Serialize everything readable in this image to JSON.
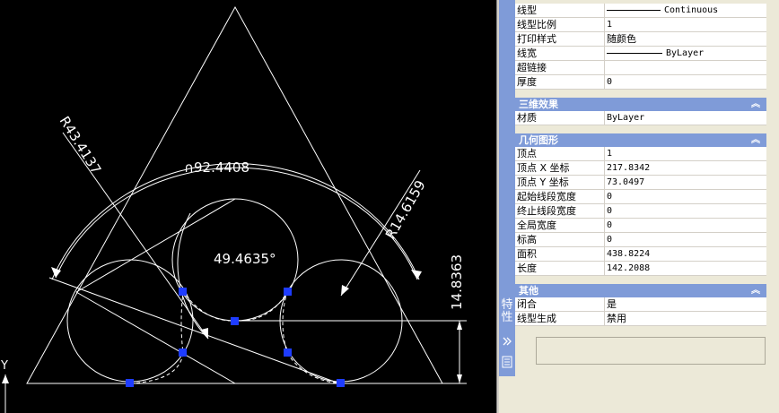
{
  "drawing": {
    "dimensions": {
      "arc_length": "∩92.4408",
      "angle": "49.4635°",
      "radius_left": "R43.4137",
      "radius_right": "R14.6159",
      "vertical": "14.8363"
    },
    "ucs_axis": "Y"
  },
  "properties_panel": {
    "title": "特性",
    "general_rows": [
      {
        "label": "线型",
        "value": "Continuous",
        "sample": true
      },
      {
        "label": "线型比例",
        "value": "1"
      },
      {
        "label": "打印样式",
        "value": "随颜色"
      },
      {
        "label": "线宽",
        "value": "ByLayer",
        "sample": true
      },
      {
        "label": "超链接",
        "value": ""
      },
      {
        "label": "厚度",
        "value": "0"
      }
    ],
    "section_3d": {
      "title": "三维效果",
      "rows": [
        {
          "label": "材质",
          "value": "ByLayer"
        }
      ]
    },
    "section_geometry": {
      "title": "几何图形",
      "rows": [
        {
          "label": "顶点",
          "value": "1"
        },
        {
          "label": "顶点 X 坐标",
          "value": "217.8342"
        },
        {
          "label": "顶点 Y 坐标",
          "value": "73.0497"
        },
        {
          "label": "起始线段宽度",
          "value": "0"
        },
        {
          "label": "终止线段宽度",
          "value": "0"
        },
        {
          "label": "全局宽度",
          "value": "0"
        },
        {
          "label": "标高",
          "value": "0"
        },
        {
          "label": "面积",
          "value": "438.8224"
        },
        {
          "label": "长度",
          "value": "142.2088"
        }
      ]
    },
    "section_other": {
      "title": "其他",
      "rows": [
        {
          "label": "闭合",
          "value": "是"
        },
        {
          "label": "线型生成",
          "value": "禁用"
        }
      ]
    }
  }
}
